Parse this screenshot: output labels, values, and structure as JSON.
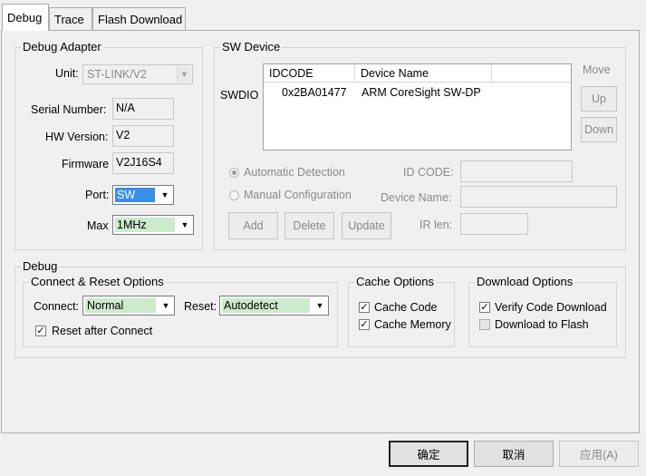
{
  "tabs": [
    "Debug",
    "Trace",
    "Flash Download"
  ],
  "debug_adapter": {
    "title": "Debug Adapter",
    "unit_label": "Unit:",
    "unit_value": "ST-LINK/V2",
    "serial_label": "Serial Number:",
    "serial_value": "N/A",
    "hw_label": "HW Version:",
    "hw_value": "V2",
    "fw_label": "Firmware",
    "fw_value": "V2J16S4",
    "port_label": "Port:",
    "port_value": "SW",
    "max_label": "Max",
    "max_value": "1MHz"
  },
  "sw_device": {
    "title": "SW Device",
    "row_label": "SWDIO",
    "col_idcode": "IDCODE",
    "col_name": "Device Name",
    "row_idcode": "0x2BA01477",
    "row_name": "ARM CoreSight SW-DP",
    "move_label": "Move",
    "up_label": "Up",
    "down_label": "Down",
    "auto_label": "Automatic Detection",
    "manual_label": "Manual Configuration",
    "idcode_label": "ID CODE:",
    "devname_label": "Device Name:",
    "irlen_label": "IR len:",
    "add_label": "Add",
    "delete_label": "Delete",
    "update_label": "Update"
  },
  "debug": {
    "title": "Debug",
    "connect_reset": {
      "title": "Connect & Reset Options",
      "connect_label": "Connect:",
      "connect_value": "Normal",
      "reset_label": "Reset:",
      "reset_value": "Autodetect",
      "reset_after_label": "Reset after Connect"
    },
    "cache": {
      "title": "Cache Options",
      "code_label": "Cache Code",
      "memory_label": "Cache Memory"
    },
    "download": {
      "title": "Download Options",
      "verify_label": "Verify Code Download",
      "flash_label": "Download to Flash"
    }
  },
  "footer": {
    "ok_label": "确定",
    "cancel_label": "取消",
    "apply_label": "应用(A)"
  },
  "colors": {
    "selection_blue": "#3b8fe6",
    "selection_green": "#cdeacd"
  },
  "icons": {
    "dropdown": "chevron-down-icon",
    "check": "checkmark-icon"
  }
}
